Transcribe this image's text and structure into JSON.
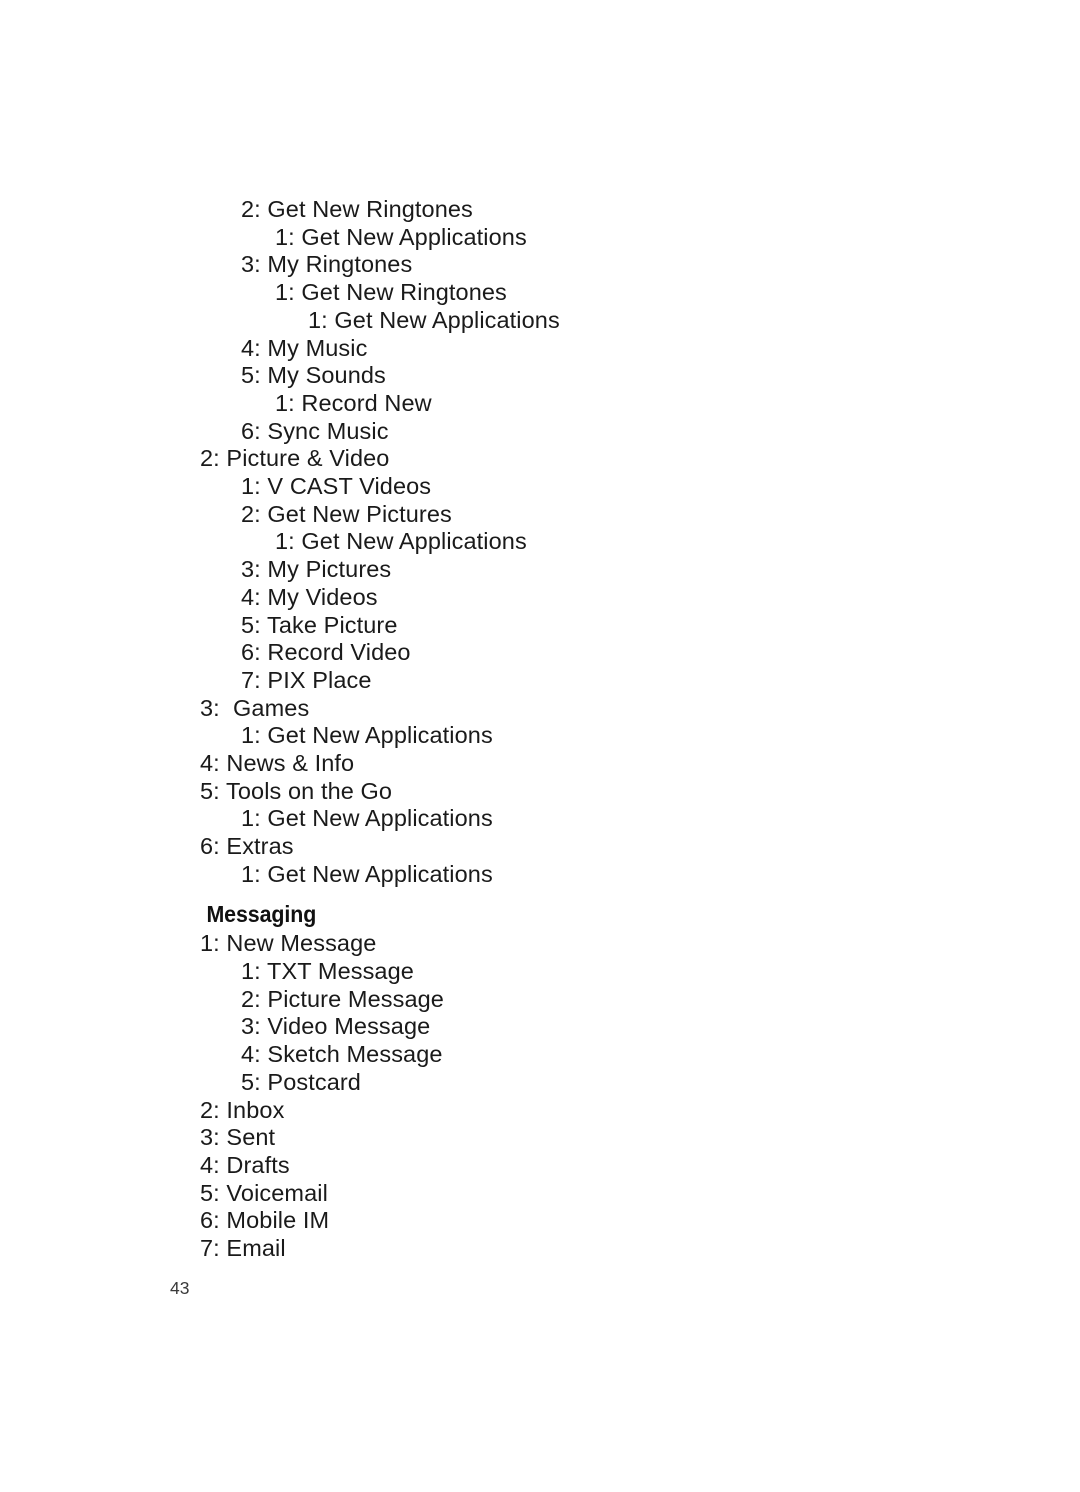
{
  "document": {
    "page_number": "43",
    "blocks": [
      {
        "type": "list",
        "items": [
          {
            "level": 2,
            "text": "2: Get New Ringtones"
          },
          {
            "level": 3,
            "text": "1: Get New Applications"
          },
          {
            "level": 2,
            "text": "3: My Ringtones"
          },
          {
            "level": 3,
            "text": "1: Get New Ringtones"
          },
          {
            "level": 4,
            "text": "1: Get New Applications"
          },
          {
            "level": 2,
            "text": "4: My Music"
          },
          {
            "level": 2,
            "text": "5: My Sounds"
          },
          {
            "level": 3,
            "text": "1: Record New"
          },
          {
            "level": 2,
            "text": "6: Sync Music"
          },
          {
            "level": 1,
            "text": "2: Picture & Video"
          },
          {
            "level": 2,
            "text": "1: V CAST Videos"
          },
          {
            "level": 2,
            "text": "2: Get New Pictures"
          },
          {
            "level": 3,
            "text": "1: Get New Applications"
          },
          {
            "level": 2,
            "text": "3: My Pictures"
          },
          {
            "level": 2,
            "text": "4: My Videos"
          },
          {
            "level": 2,
            "text": "5: Take Picture"
          },
          {
            "level": 2,
            "text": "6: Record Video"
          },
          {
            "level": 2,
            "text": "7: PIX Place"
          },
          {
            "level": 1,
            "text": "3:  Games"
          },
          {
            "level": 2,
            "text": "1: Get New Applications"
          },
          {
            "level": 1,
            "text": "4: News & Info"
          },
          {
            "level": 1,
            "text": "5: Tools on the Go"
          },
          {
            "level": 2,
            "text": "1: Get New Applications"
          },
          {
            "level": 1,
            "text": "6: Extras"
          },
          {
            "level": 2,
            "text": "1: Get New Applications"
          }
        ]
      },
      {
        "type": "heading",
        "text": "Messaging"
      },
      {
        "type": "list",
        "items": [
          {
            "level": 1,
            "text": "1: New Message"
          },
          {
            "level": 2,
            "text": "1: TXT Message"
          },
          {
            "level": 2,
            "text": "2: Picture Message"
          },
          {
            "level": 2,
            "text": "3: Video Message"
          },
          {
            "level": 2,
            "text": "4: Sketch Message"
          },
          {
            "level": 2,
            "text": "5: Postcard"
          },
          {
            "level": 1,
            "text": "2: Inbox"
          },
          {
            "level": 1,
            "text": "3: Sent"
          },
          {
            "level": 1,
            "text": "4: Drafts"
          },
          {
            "level": 1,
            "text": "5: Voicemail"
          },
          {
            "level": 1,
            "text": "6: Mobile IM"
          },
          {
            "level": 1,
            "text": "7: Email"
          }
        ]
      }
    ]
  }
}
